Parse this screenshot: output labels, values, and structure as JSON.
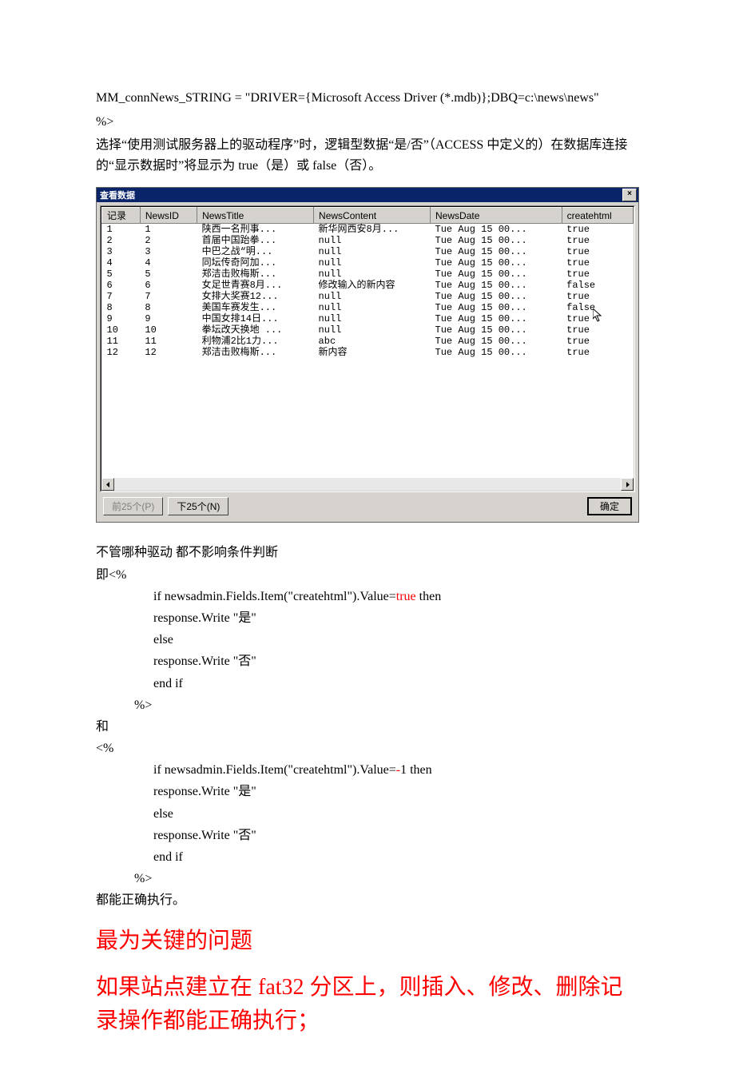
{
  "top": {
    "line1": "MM_connNews_STRING = \"DRIVER={Microsoft Access Driver (*.mdb)};DBQ=c:\\news\\news\"",
    "line2": "%>",
    "line3": "选择“使用测试服务器上的驱动程序”时，逻辑型数据“是/否”（ACCESS 中定义的）在数据库连接的“显示数据时”将显示为 true（是）或 false（否）。"
  },
  "dialog": {
    "title": "查看数据",
    "close": "×",
    "headers": [
      "记录",
      "NewsID",
      "NewsTitle",
      "NewsContent",
      "NewsDate",
      "createhtml"
    ],
    "rows": [
      [
        "1",
        "1",
        "陕西一名刑事...",
        "新华网西安8月...",
        "Tue Aug 15 00...",
        "true"
      ],
      [
        "2",
        "2",
        "首届中国跆拳...",
        "null",
        "Tue Aug 15 00...",
        "true"
      ],
      [
        "3",
        "3",
        "中巴之战“明...",
        "null",
        "Tue Aug 15 00...",
        "true"
      ],
      [
        "4",
        "4",
        "同坛传奇阿加...",
        "null",
        "Tue Aug 15 00...",
        "true"
      ],
      [
        "5",
        "5",
        "郑洁击败梅斯...",
        "null",
        "Tue Aug 15 00...",
        "true"
      ],
      [
        "6",
        "6",
        "女足世青赛8月...",
        "修改输入的新内容",
        "Tue Aug 15 00...",
        "false"
      ],
      [
        "7",
        "7",
        "女排大奖赛12...",
        "null",
        "Tue Aug 15 00...",
        "true"
      ],
      [
        "8",
        "8",
        "美国车赛发生...",
        "null",
        "Tue Aug 15 00...",
        "false"
      ],
      [
        "9",
        "9",
        "中国女排14日...",
        "null",
        "Tue Aug 15 00...",
        "true"
      ],
      [
        "10",
        "10",
        "拳坛改天换地 ...",
        "null",
        "Tue Aug 15 00...",
        "true"
      ],
      [
        "11",
        "11",
        "利物浦2比1力...",
        "abc",
        "Tue Aug 15 00...",
        "true"
      ],
      [
        "12",
        "12",
        "郑洁击败梅斯...",
        "新内容",
        "Tue Aug 15 00...",
        "true"
      ]
    ],
    "btn_prev": "前25个(P)",
    "btn_next": "下25个(N)",
    "btn_ok": "确定"
  },
  "mid": {
    "l1": "不管哪种驱动  都不影响条件判断",
    "l2": "即<%",
    "c1": "if newsadmin.Fields.Item(\"createhtml\").Value=",
    "c1r": "true",
    "c1b": " then",
    "c2": "   response.Write \"是\"",
    "c3": "else",
    "c4": "   response.Write \"否\"",
    "c5": "end if",
    "c6": "%>",
    "l3": "和",
    "l4": "<%",
    "d1": "if newsadmin.Fields.Item(\"createhtml\").Value=",
    "d1r": "-",
    "d1b": "1 then",
    "d2": "   response.Write \"是\"",
    "d3": "else",
    "d4": "   response.Write \"否\"",
    "d5": "end if",
    "d6": "%>",
    "l5": "都能正确执行。"
  },
  "headline": {
    "h1": "最为关键的问题",
    "h2": "如果站点建立在 fat32 分区上，则插入、修改、删除记录操作都能正确执行；"
  }
}
